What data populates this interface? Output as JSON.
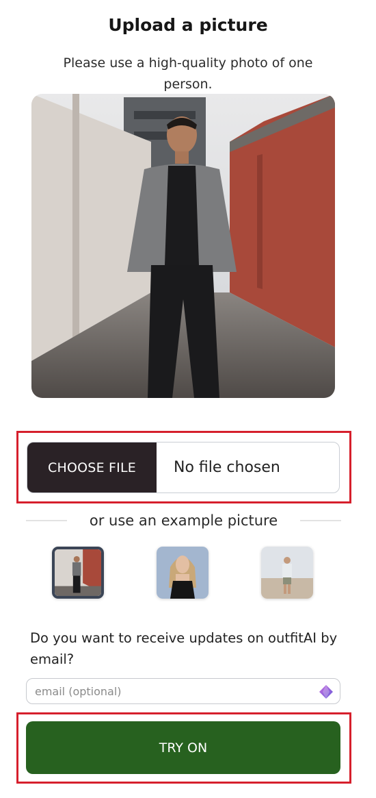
{
  "page": {
    "title": "Upload a picture",
    "subtitle": "Please use a high-quality photo of one person."
  },
  "upload": {
    "choose_label": "CHOOSE FILE",
    "status": "No file chosen"
  },
  "examples": {
    "divider_text": "or use an example picture",
    "items": [
      {
        "name": "example-man-alley",
        "selected": true
      },
      {
        "name": "example-woman-black-top",
        "selected": false
      },
      {
        "name": "example-man-beach",
        "selected": false
      }
    ]
  },
  "newsletter": {
    "question": "Do you want to receive updates on outfitAI by email?",
    "email_placeholder": "email (optional)",
    "email_value": ""
  },
  "action": {
    "try_on_label": "TRY ON"
  },
  "colors": {
    "choose_button_bg": "#2a2226",
    "try_button_bg": "#27611f",
    "highlight_border": "#d61f2c",
    "selected_example_border": "#3b4556"
  },
  "icons": {
    "email_field_icon": "gem-icon"
  }
}
